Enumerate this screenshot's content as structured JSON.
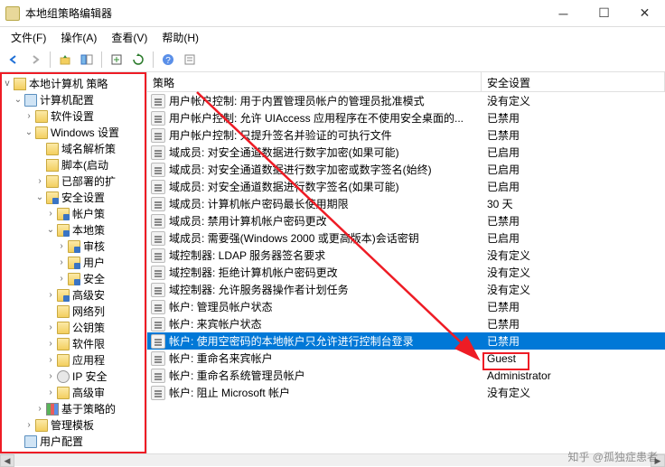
{
  "window": {
    "title": "本地组策略编辑器"
  },
  "menus": [
    "文件(F)",
    "操作(A)",
    "查看(V)",
    "帮助(H)"
  ],
  "tree": {
    "root": "本地计算机 策略",
    "nodes": [
      {
        "label": "计算机配置",
        "indent": 1,
        "icon": "computer-icon",
        "exp": "v"
      },
      {
        "label": "软件设置",
        "indent": 2,
        "icon": "folder",
        "exp": ">"
      },
      {
        "label": "Windows 设置",
        "indent": 2,
        "icon": "folder",
        "exp": "v"
      },
      {
        "label": "域名解析策",
        "indent": 3,
        "icon": "folder",
        "exp": ""
      },
      {
        "label": "脚本(启动",
        "indent": 3,
        "icon": "book-icon",
        "exp": ""
      },
      {
        "label": "已部署的扩",
        "indent": 3,
        "icon": "folder",
        "exp": ">"
      },
      {
        "label": "安全设置",
        "indent": 3,
        "icon": "folder-sec",
        "exp": "v"
      },
      {
        "label": "帐户策",
        "indent": 4,
        "icon": "folder-sec",
        "exp": ">"
      },
      {
        "label": "本地策",
        "indent": 4,
        "icon": "folder-sec",
        "exp": "v"
      },
      {
        "label": "审核",
        "indent": 5,
        "icon": "folder-sec",
        "exp": ">"
      },
      {
        "label": "用户",
        "indent": 5,
        "icon": "folder-sec",
        "exp": ">"
      },
      {
        "label": "安全",
        "indent": 5,
        "icon": "folder-sec",
        "exp": ">"
      },
      {
        "label": "高级安",
        "indent": 4,
        "icon": "folder-sec",
        "exp": ">"
      },
      {
        "label": "网络列",
        "indent": 4,
        "icon": "folder",
        "exp": ""
      },
      {
        "label": "公钥策",
        "indent": 4,
        "icon": "folder",
        "exp": ">"
      },
      {
        "label": "软件限",
        "indent": 4,
        "icon": "folder",
        "exp": ">"
      },
      {
        "label": "应用程",
        "indent": 4,
        "icon": "folder",
        "exp": ">"
      },
      {
        "label": "IP 安全",
        "indent": 4,
        "icon": "gear-icon",
        "exp": ">"
      },
      {
        "label": "高级审",
        "indent": 4,
        "icon": "folder",
        "exp": ">"
      },
      {
        "label": "基于策略的",
        "indent": 3,
        "icon": "chart-icon",
        "exp": ">"
      },
      {
        "label": "管理模板",
        "indent": 2,
        "icon": "folder",
        "exp": ">"
      },
      {
        "label": "用户配置",
        "indent": 1,
        "icon": "computer-icon",
        "exp": ""
      }
    ]
  },
  "list": {
    "headers": {
      "policy": "策略",
      "setting": "安全设置"
    },
    "rows": [
      {
        "name": "用户帐户控制: 用于内置管理员帐户的管理员批准模式",
        "setting": "没有定义"
      },
      {
        "name": "用户帐户控制: 允许 UIAccess 应用程序在不使用安全桌面的...",
        "setting": "已禁用"
      },
      {
        "name": "用户帐户控制: 只提升签名并验证的可执行文件",
        "setting": "已禁用"
      },
      {
        "name": "域成员: 对安全通道数据进行数字加密(如果可能)",
        "setting": "已启用"
      },
      {
        "name": "域成员: 对安全通道数据进行数字加密或数字签名(始终)",
        "setting": "已启用"
      },
      {
        "name": "域成员: 对安全通道数据进行数字签名(如果可能)",
        "setting": "已启用"
      },
      {
        "name": "域成员: 计算机帐户密码最长使用期限",
        "setting": "30 天"
      },
      {
        "name": "域成员: 禁用计算机帐户密码更改",
        "setting": "已禁用"
      },
      {
        "name": "域成员: 需要强(Windows 2000 或更高版本)会话密钥",
        "setting": "已启用"
      },
      {
        "name": "域控制器: LDAP 服务器签名要求",
        "setting": "没有定义"
      },
      {
        "name": "域控制器: 拒绝计算机帐户密码更改",
        "setting": "没有定义"
      },
      {
        "name": "域控制器: 允许服务器操作者计划任务",
        "setting": "没有定义"
      },
      {
        "name": "帐户: 管理员帐户状态",
        "setting": "已禁用"
      },
      {
        "name": "帐户: 来宾帐户状态",
        "setting": "已禁用"
      },
      {
        "name": "帐户: 使用空密码的本地帐户只允许进行控制台登录",
        "setting": "已禁用",
        "selected": true
      },
      {
        "name": "帐户: 重命名来宾帐户",
        "setting": "Guest"
      },
      {
        "name": "帐户: 重命名系统管理员帐户",
        "setting": "Administrator"
      },
      {
        "name": "帐户: 阻止 Microsoft 帐户",
        "setting": "没有定义"
      }
    ]
  },
  "watermark": "知乎 @孤独症患者"
}
